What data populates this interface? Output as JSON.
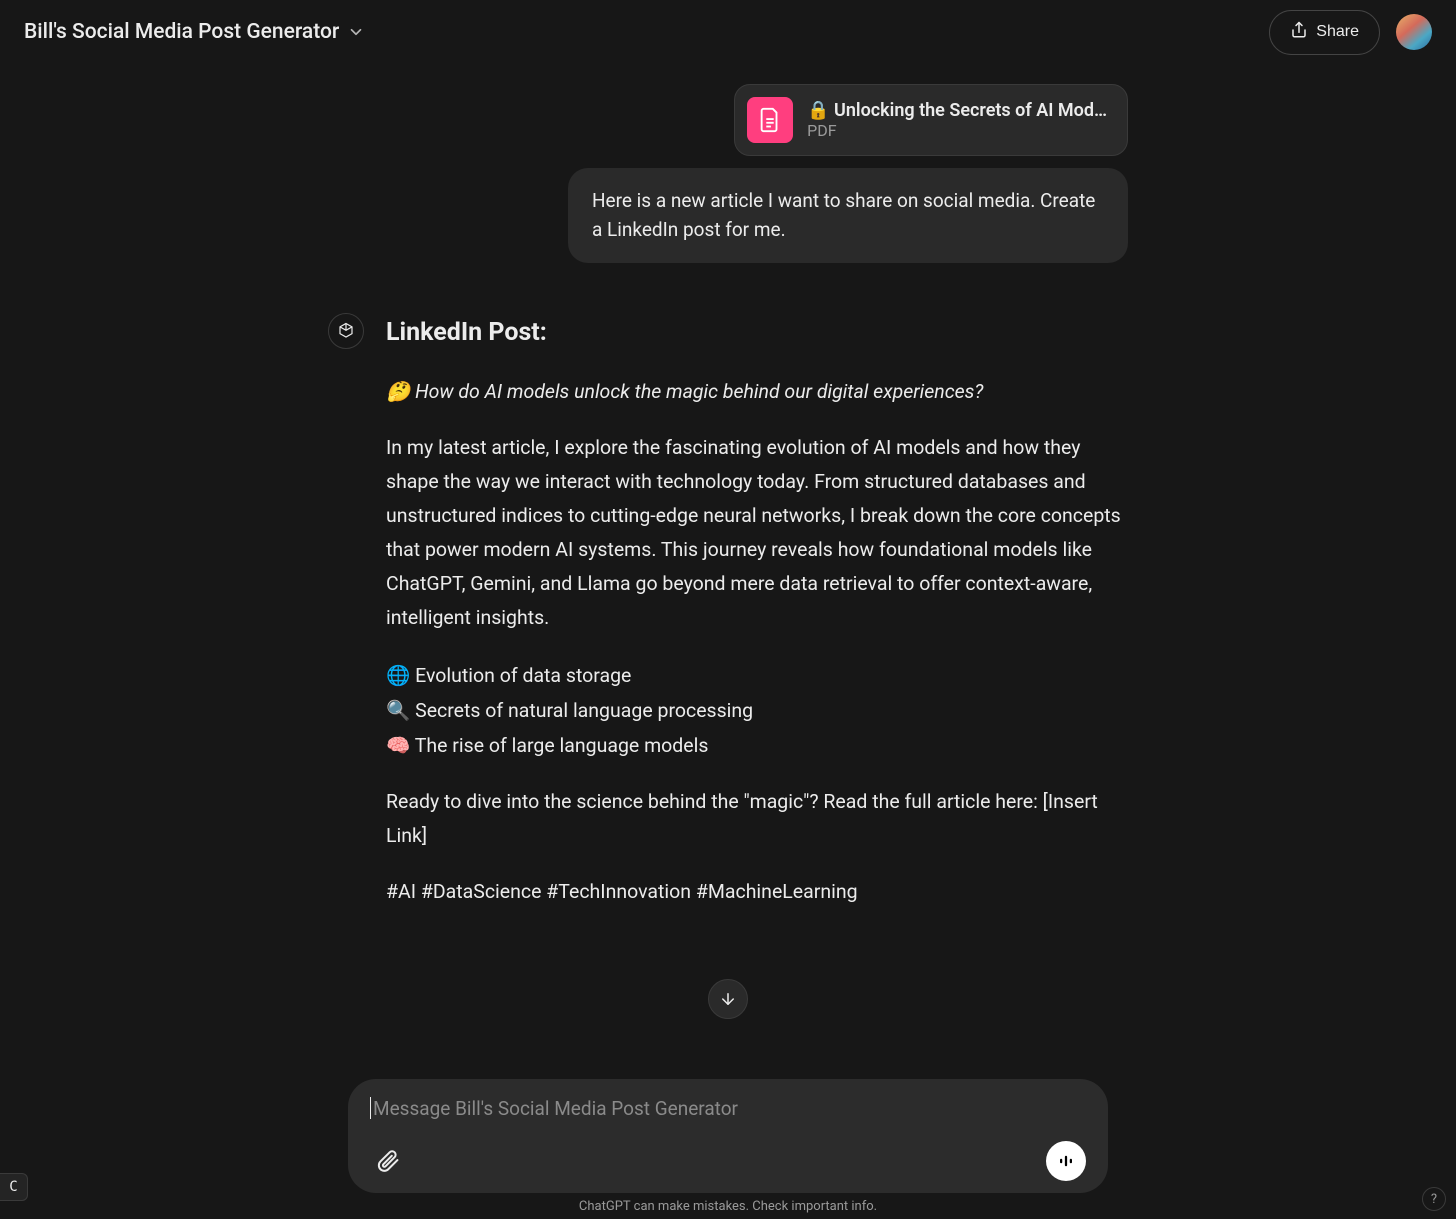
{
  "header": {
    "title": "Bill's Social Media Post Generator",
    "share_label": "Share"
  },
  "user": {
    "attachment": {
      "title": "🔒 Unlocking the Secrets of AI Mod…",
      "subtitle": "PDF"
    },
    "message": "Here is a new article I want to share on social media. Create a LinkedIn post for me."
  },
  "assistant": {
    "heading": "LinkedIn Post:",
    "hook": "🤔 How do AI models unlock the magic behind our digital experiences?",
    "body": "In my latest article, I explore the fascinating evolution of AI models and how they shape the way we interact with technology today. From structured databases and unstructured indices to cutting-edge neural networks, I break down the core concepts that power modern AI systems. This journey reveals how foundational models like ChatGPT, Gemini, and Llama go beyond mere data retrieval to offer context-aware, intelligent insights.",
    "bullets": [
      "🌐 Evolution of data storage",
      "🔍 Secrets of natural language processing",
      "🧠 The rise of large language models"
    ],
    "cta": "Ready to dive into the science behind the \"magic\"? Read the full article here: [Insert Link]",
    "hashtags": "#AI #DataScience #TechInnovation #MachineLearning"
  },
  "input": {
    "placeholder": "Message Bill's Social Media Post Generator"
  },
  "footer": {
    "note": "ChatGPT can make mistakes. Check important info.",
    "help": "?",
    "corner": "C"
  }
}
